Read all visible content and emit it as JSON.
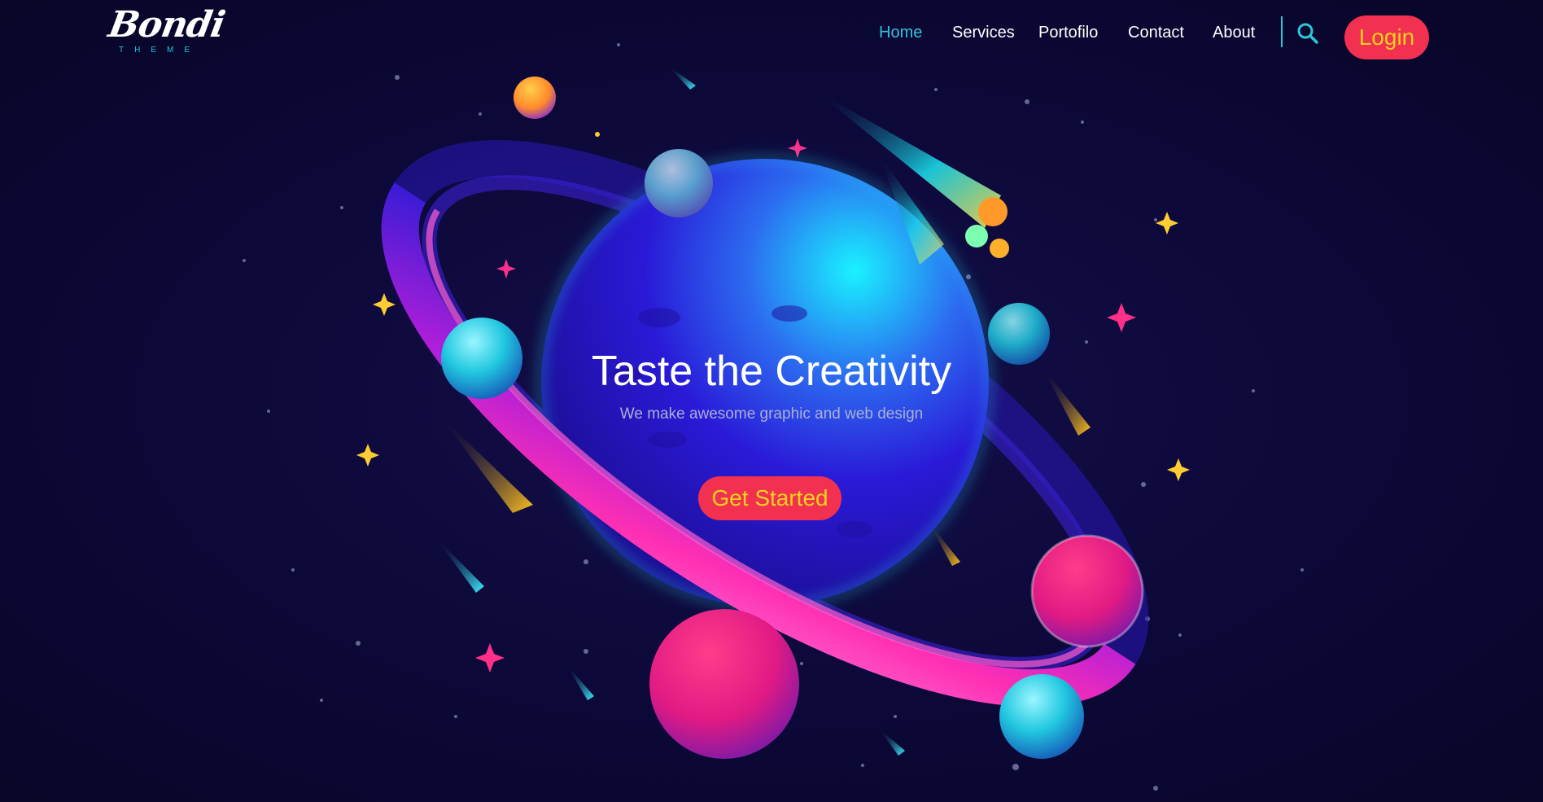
{
  "brand": {
    "name": "Bondi",
    "tagline": "THEME"
  },
  "nav": {
    "items": [
      {
        "label": "Home",
        "active": true
      },
      {
        "label": "Services",
        "active": false
      },
      {
        "label": "Portofilo",
        "active": false
      },
      {
        "label": "Contact",
        "active": false
      },
      {
        "label": "About",
        "active": false
      }
    ],
    "search_icon": "search-icon",
    "login_label": "Login"
  },
  "hero": {
    "title": "Taste the Creativity",
    "subtitle": "We make awesome graphic and web design",
    "cta_label": "Get Started"
  },
  "colors": {
    "background": "#0c0838",
    "accent_cyan": "#2fc6d8",
    "button_red": "#f2304f",
    "button_text_yellow": "#f5d21c"
  }
}
